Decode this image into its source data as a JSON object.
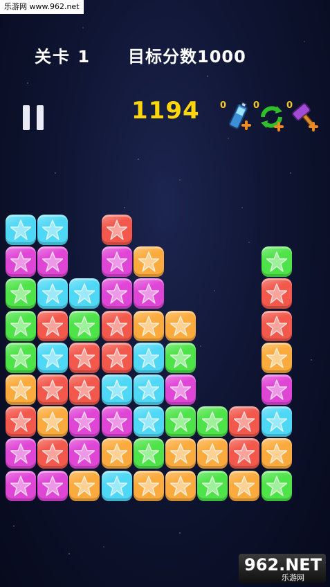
{
  "watermark_top": "乐游网 www.962.net",
  "header": {
    "level_label": "关卡 1",
    "target_label": "目标分数1000"
  },
  "score": "1194",
  "powerups": [
    {
      "name": "battery-plus-icon",
      "count": "0"
    },
    {
      "name": "refresh-plus-icon",
      "count": "0"
    },
    {
      "name": "hammer-plus-icon",
      "count": "0"
    }
  ],
  "colors": {
    "cyan": "#4fd8f5",
    "pink": "#e046d6",
    "red": "#f2584c",
    "green": "#4fe34a",
    "orange": "#fbab3d",
    "score": "#ffd60a"
  },
  "board": {
    "columns": 9,
    "rows": 9,
    "grid": [
      [
        "cyan",
        "cyan",
        null,
        "red",
        null,
        null,
        null,
        null,
        null
      ],
      [
        "pink",
        "pink",
        null,
        "pink",
        "orange",
        null,
        null,
        null,
        "green"
      ],
      [
        "green",
        "cyan",
        "cyan",
        "pink",
        "pink",
        null,
        null,
        null,
        "red"
      ],
      [
        "green",
        "red",
        "green",
        "red",
        "orange",
        "orange",
        null,
        null,
        "red"
      ],
      [
        "green",
        "cyan",
        "red",
        "red",
        "cyan",
        "green",
        null,
        null,
        "orange"
      ],
      [
        "orange",
        "red",
        "red",
        "cyan",
        "cyan",
        "pink",
        null,
        null,
        "pink"
      ],
      [
        "red",
        "orange",
        "pink",
        "pink",
        "cyan",
        "green",
        "green",
        "red",
        "cyan"
      ],
      [
        "pink",
        "red",
        "pink",
        "orange",
        "green",
        "orange",
        "orange",
        "red",
        "orange"
      ],
      [
        "pink",
        "pink",
        "orange",
        "cyan",
        "orange",
        "orange",
        "green",
        "orange",
        "green"
      ]
    ]
  },
  "watermark_br": {
    "main": "962.NET",
    "sub": "乐游网"
  }
}
